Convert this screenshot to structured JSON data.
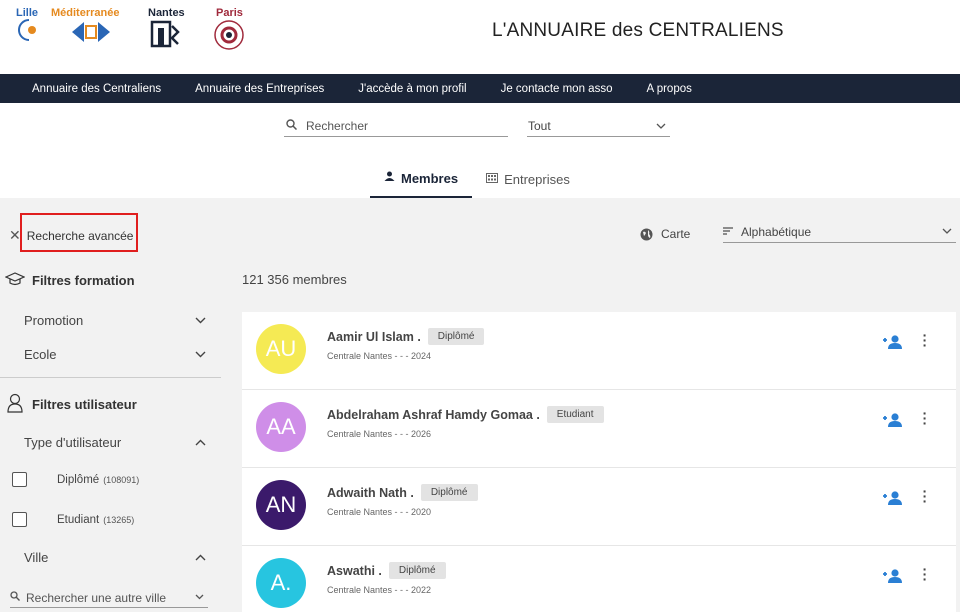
{
  "header": {
    "logos": [
      {
        "label": "Lille",
        "color": "#2a66b5"
      },
      {
        "label": "Méditerranée",
        "color": "#e58a1f"
      },
      {
        "label": "Nantes",
        "color": "#1b2538"
      },
      {
        "label": "Paris",
        "color": "#a02a3c"
      }
    ],
    "title": "L'ANNUAIRE des CENTRALIENS"
  },
  "nav": {
    "items": [
      "Annuaire des Centraliens",
      "Annuaire des Entreprises",
      "J'accède à mon profil",
      "Je contacte mon asso",
      "A propos"
    ]
  },
  "search": {
    "placeholder": "Rechercher",
    "scope_value": "Tout"
  },
  "tabs": [
    {
      "label": "Membres",
      "icon": "person-icon",
      "active": true
    },
    {
      "label": "Entreprises",
      "icon": "building-icon",
      "active": false
    }
  ],
  "toolbar": {
    "advanced_label": "Recherche avancée",
    "map_label": "Carte",
    "sort_value": "Alphabétique"
  },
  "sidebar": {
    "formation_heading": "Filtres formation",
    "promotion_label": "Promotion",
    "ecole_label": "Ecole",
    "user_heading": "Filtres utilisateur",
    "type_label": "Type d'utilisateur",
    "types": [
      {
        "label": "Diplômé",
        "count": "(108091)"
      },
      {
        "label": "Etudiant",
        "count": "(13265)"
      }
    ],
    "ville_label": "Ville",
    "ville_placeholder": "Rechercher une autre ville"
  },
  "results": {
    "count_text": "121 356 membres"
  },
  "members": [
    {
      "initials": "AU",
      "name": "Aamir Ul Islam .",
      "status": "Diplômé",
      "sub": "Centrale Nantes - - - 2024",
      "color": "#f5ea54"
    },
    {
      "initials": "AA",
      "name": "Abdelraham Ashraf Hamdy Gomaa .",
      "status": "Etudiant",
      "sub": "Centrale Nantes - - - 2026",
      "color": "#cf8ee8"
    },
    {
      "initials": "AN",
      "name": "Adwaith Nath .",
      "status": "Diplômé",
      "sub": "Centrale Nantes - - - 2020",
      "color": "#3b1a6b"
    },
    {
      "initials": "A.",
      "name": "Aswathi .",
      "status": "Diplômé",
      "sub": "Centrale Nantes - - - 2022",
      "color": "#27c5e0"
    }
  ],
  "colors": {
    "nav_bg": "#1b2538",
    "accent_blue": "#2a7fd4",
    "highlight_red": "#e01e1e"
  }
}
